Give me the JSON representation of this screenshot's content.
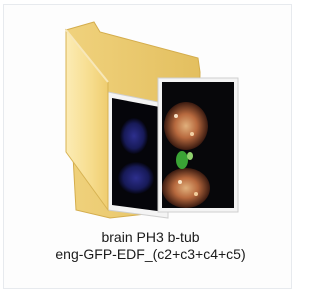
{
  "item": {
    "name_line1": "brain PH3 b-tub",
    "name_line2": "eng-GFP-EDF_(c2+c3+c4+c5)",
    "icon": "folder-with-image-thumbnails-icon",
    "selected": true,
    "colors": {
      "selection_border": "#e7eaee",
      "folder_light": "#f9e3a0",
      "folder_dark": "#e6c263",
      "text": "#1a1a1a"
    }
  }
}
